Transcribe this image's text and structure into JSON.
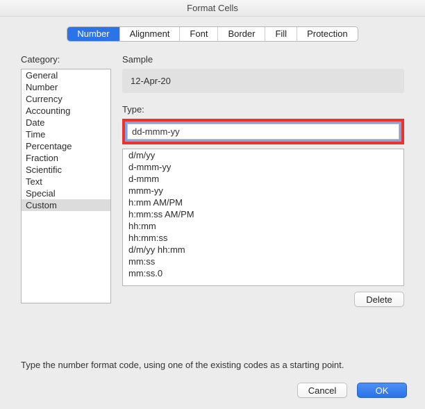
{
  "window": {
    "title": "Format Cells"
  },
  "tabs": [
    {
      "label": "Number",
      "selected": true
    },
    {
      "label": "Alignment",
      "selected": false
    },
    {
      "label": "Font",
      "selected": false
    },
    {
      "label": "Border",
      "selected": false
    },
    {
      "label": "Fill",
      "selected": false
    },
    {
      "label": "Protection",
      "selected": false
    }
  ],
  "category": {
    "label": "Category:",
    "items": [
      "General",
      "Number",
      "Currency",
      "Accounting",
      "Date",
      "Time",
      "Percentage",
      "Fraction",
      "Scientific",
      "Text",
      "Special",
      "Custom"
    ],
    "selected": "Custom"
  },
  "sample": {
    "label": "Sample",
    "value": "12-Apr-20"
  },
  "type": {
    "label": "Type:",
    "value": "dd-mmm-yy",
    "formats": [
      "d/m/yy",
      "d-mmm-yy",
      "d-mmm",
      "mmm-yy",
      "h:mm AM/PM",
      "h:mm:ss AM/PM",
      "hh:mm",
      "hh:mm:ss",
      "d/m/yy hh:mm",
      "mm:ss",
      "mm:ss.0"
    ]
  },
  "buttons": {
    "delete": "Delete",
    "cancel": "Cancel",
    "ok": "OK"
  },
  "hint": "Type the number format code, using one of the existing codes as a starting point."
}
